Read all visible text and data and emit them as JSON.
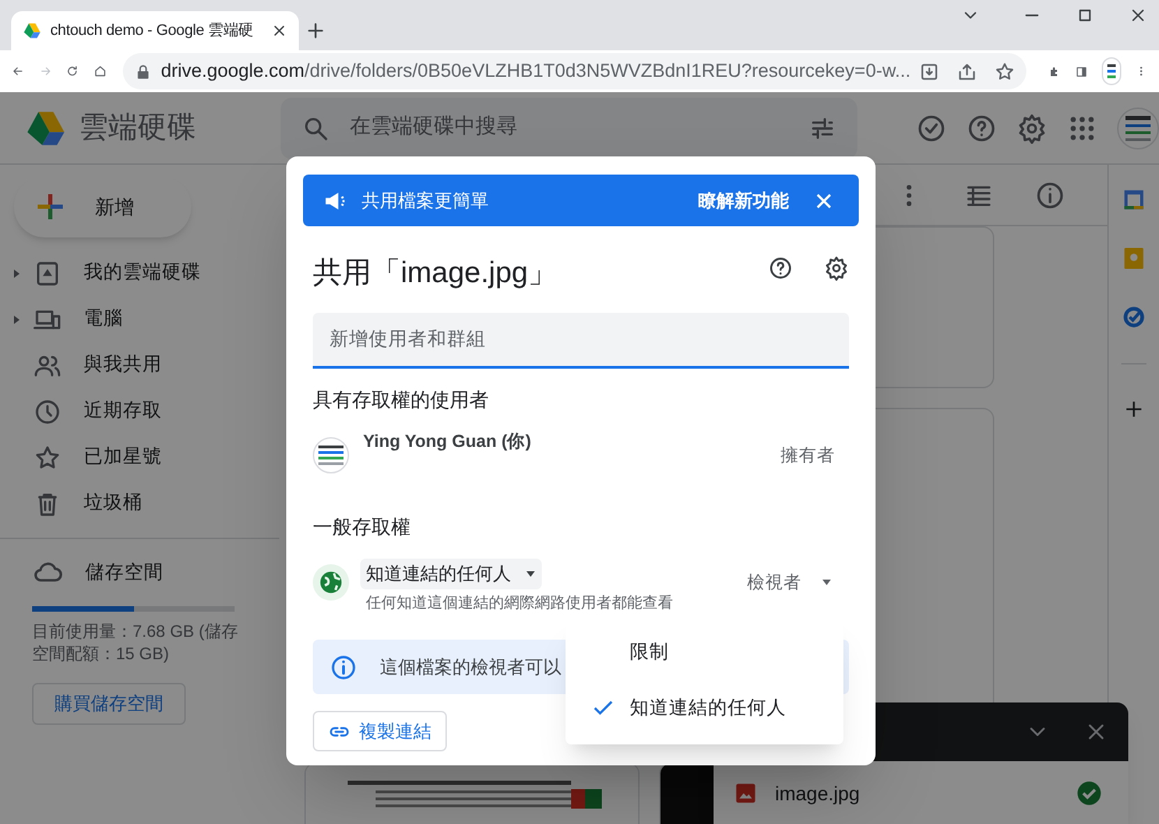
{
  "browser": {
    "tab_title": "chtouch demo - Google 雲端硬",
    "url_host": "drive.google.com",
    "url_rest": "/drive/folders/0B50eVLZHB1T0d3N5WVZBdnI1REU?resourcekey=0-w..."
  },
  "drive": {
    "app_name": "雲端硬碟",
    "search_placeholder": "在雲端硬碟中搜尋",
    "new_button": "新增",
    "nav": [
      {
        "label": "我的雲端硬碟",
        "expandable": true
      },
      {
        "label": "電腦",
        "expandable": true
      },
      {
        "label": "與我共用",
        "expandable": false
      },
      {
        "label": "近期存取",
        "expandable": false
      },
      {
        "label": "已加星號",
        "expandable": false
      },
      {
        "label": "垃圾桶",
        "expandable": false
      }
    ],
    "storage": {
      "label": "儲存空間",
      "level": 0.5,
      "usage": "目前使用量：7.68 GB (儲存空間配額：15 GB)",
      "buy_button": "購買儲存空間"
    }
  },
  "dialog": {
    "banner": {
      "text": "共用檔案更簡單",
      "link": "瞭解新功能"
    },
    "title": "共用「image.jpg」",
    "add_placeholder": "新增使用者和群組",
    "people_heading": "具有存取權的使用者",
    "people": [
      {
        "name": "Ying Yong Guan (你)",
        "role": "擁有者"
      }
    ],
    "general_heading": "一般存取權",
    "access": "知道連結的任何人",
    "access_description": "任何知道這個連結的網際網路使用者都能查看",
    "role": "檢視者",
    "info": "這個檔案的檢視者可以",
    "copy_link": "複製連結"
  },
  "access_menu": [
    {
      "label": "限制",
      "selected": false
    },
    {
      "label": "知道連結的任何人",
      "selected": true
    }
  ],
  "upload": {
    "files": [
      {
        "name": "image.jpg",
        "done": true
      }
    ]
  }
}
